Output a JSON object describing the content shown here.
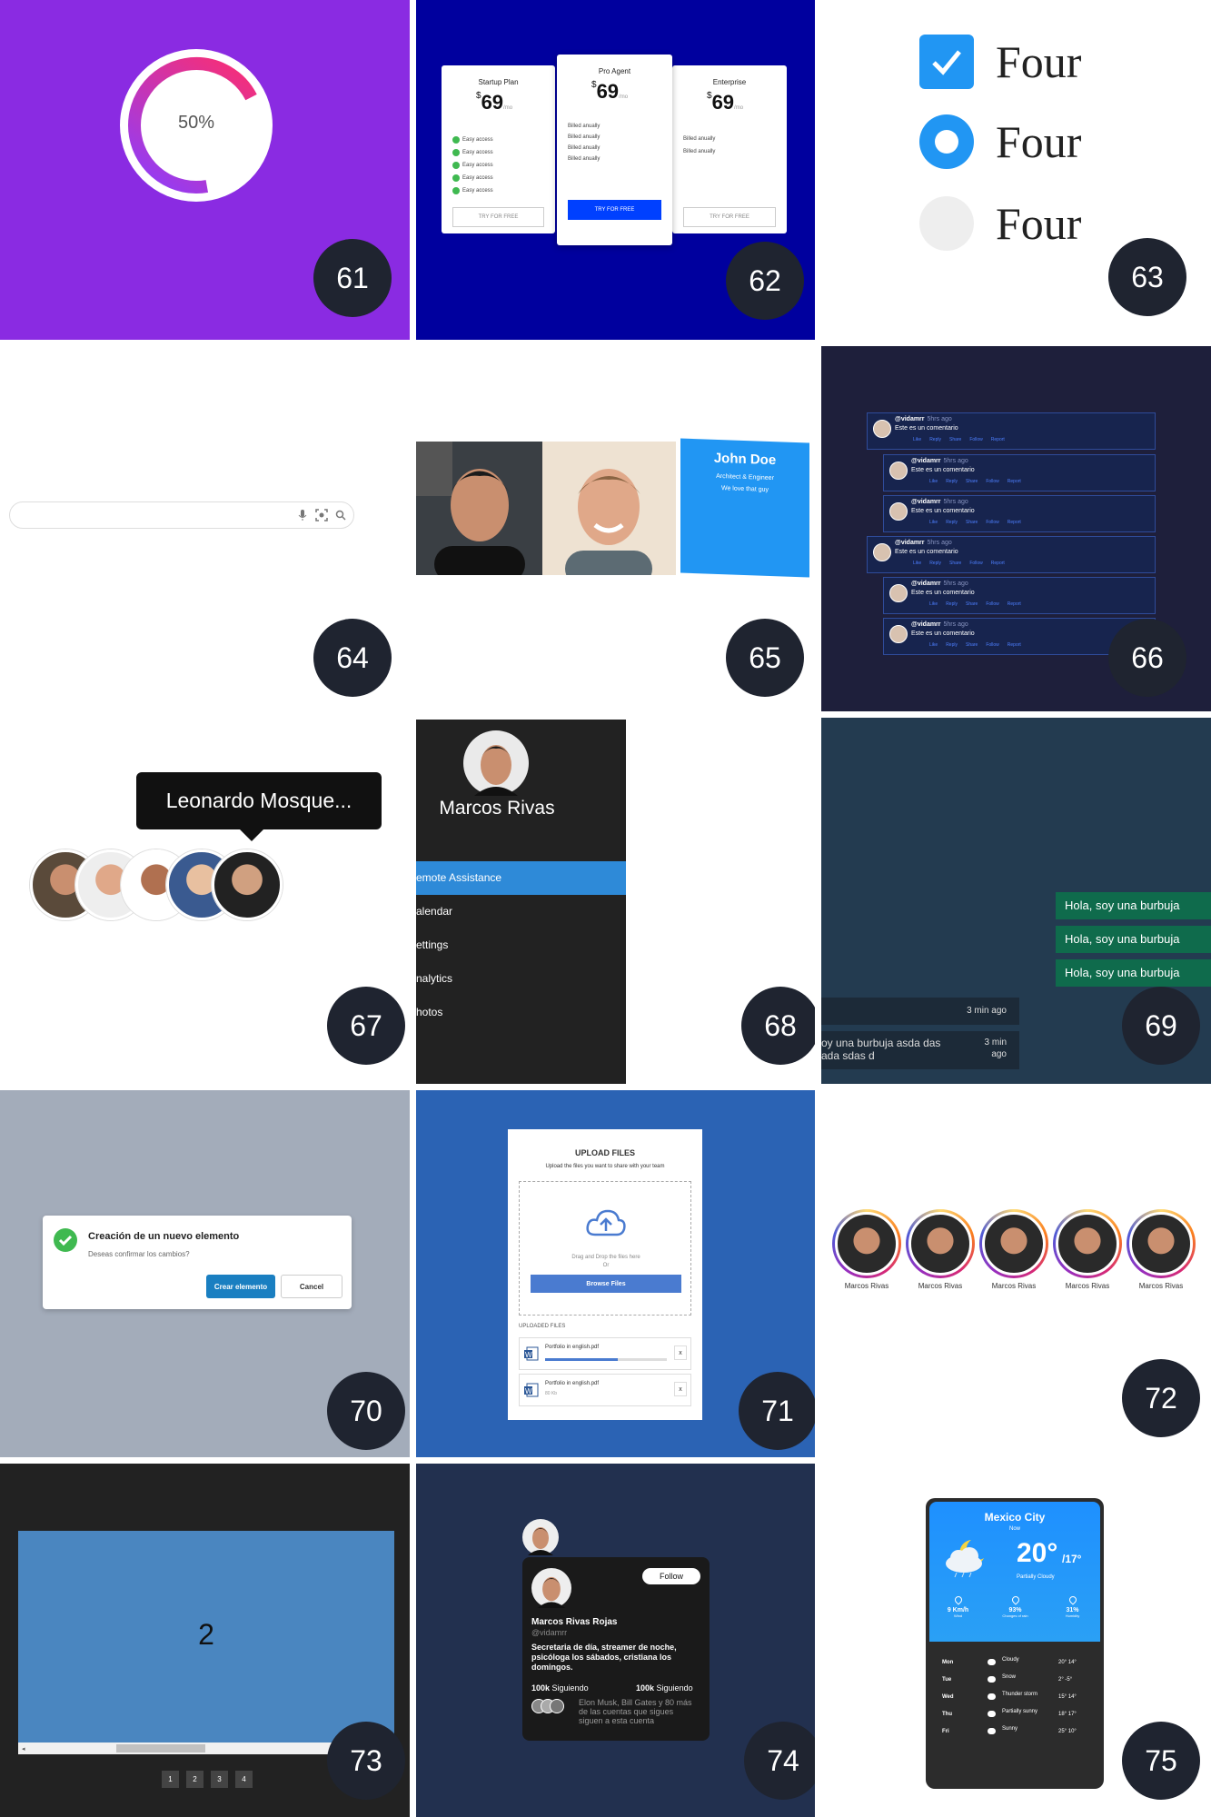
{
  "badges": [
    "61",
    "62",
    "63",
    "64",
    "65",
    "66",
    "67",
    "68",
    "69",
    "70",
    "71",
    "72",
    "73",
    "74",
    "75"
  ],
  "t61": {
    "label": "50%",
    "progress": 0.5
  },
  "t62": {
    "plans": [
      {
        "name": "Startup Plan",
        "currency": "$",
        "price": "69",
        "period": "/mo",
        "features": [
          "Easy access",
          "Easy access",
          "Easy access",
          "Easy access",
          "Easy access"
        ],
        "cta": "TRY FOR FREE"
      },
      {
        "name": "Pro Agent",
        "currency": "$",
        "price": "69",
        "period": "/mo",
        "features": [
          "Billed anually",
          "Billed anually",
          "Billed anually",
          "Billed anually"
        ],
        "cta": "TRY FOR FREE"
      },
      {
        "name": "Enterprise",
        "currency": "$",
        "price": "69",
        "period": "/mo",
        "features": [
          "Billed anually",
          "Billed anually"
        ],
        "cta": "TRY FOR FREE"
      }
    ]
  },
  "t63": {
    "options": [
      {
        "label": "Four",
        "type": "checkbox",
        "checked": true
      },
      {
        "label": "Four",
        "type": "radio",
        "checked": true
      },
      {
        "label": "Four",
        "type": "radio",
        "checked": false
      }
    ]
  },
  "t64": {
    "placeholder": ""
  },
  "t65": {
    "name": "John Doe",
    "role": "Architect & Engineer",
    "quote": "We love that guy"
  },
  "t66": {
    "comments": [
      {
        "user": "@vidamrr",
        "time": "5hrs ago",
        "text": "Este es un comentario",
        "actions": [
          "Like",
          "Reply",
          "Share",
          "Follow",
          "Report"
        ],
        "level": 0
      },
      {
        "user": "@vidamrr",
        "time": "5hrs ago",
        "text": "Este es un comentario",
        "actions": [
          "Like",
          "Reply",
          "Share",
          "Follow",
          "Report"
        ],
        "level": 1
      },
      {
        "user": "@vidamrr",
        "time": "5hrs ago",
        "text": "Este es un comentario",
        "actions": [
          "Like",
          "Reply",
          "Share",
          "Follow",
          "Report"
        ],
        "level": 1
      },
      {
        "user": "@vidamrr",
        "time": "5hrs ago",
        "text": "Este es un comentario",
        "actions": [
          "Like",
          "Reply",
          "Share",
          "Follow",
          "Report"
        ],
        "level": 0
      },
      {
        "user": "@vidamrr",
        "time": "5hrs ago",
        "text": "Este es un comentario",
        "actions": [
          "Like",
          "Reply",
          "Share",
          "Follow",
          "Report"
        ],
        "level": 1
      },
      {
        "user": "@vidamrr",
        "time": "5hrs ago",
        "text": "Este es un comentario",
        "actions": [
          "Like",
          "Reply",
          "Share",
          "Follow",
          "Report"
        ],
        "level": 1
      }
    ]
  },
  "t67": {
    "tooltip": "Leonardo Mosque..."
  },
  "t68": {
    "name": "Marcos Rivas",
    "menu": [
      "emote Assistance",
      "alendar",
      "ettings",
      "nalytics",
      "hotos"
    ],
    "active": 0
  },
  "t69": {
    "out": [
      "Hola, soy una burbuja",
      "Hola, soy una burbuja",
      "Hola, soy una burbuja"
    ],
    "in": [
      {
        "text": "",
        "time": "3 min ago"
      },
      {
        "text": "oy una burbuja asda das ada sdas d",
        "time": "3 min ago"
      }
    ]
  },
  "t70": {
    "title": "Creación de un nuevo elemento",
    "subtitle": "Deseas confirmar los cambios?",
    "confirm": "Crear elemento",
    "cancel": "Cancel"
  },
  "t71": {
    "title": "UPLOAD FILES",
    "subtitle": "Upload the files you want to share with your team",
    "drop": "Drag and Drop the files here",
    "or": "Or",
    "browse": "Browse Files",
    "uploaded_label": "UPLOADED FILES",
    "files": [
      {
        "name": "Portfolio in english.pdf",
        "size": "",
        "progress": 0.6,
        "close": "x"
      },
      {
        "name": "Portfolio in english.pdf",
        "size": "80 Kb",
        "progress": null,
        "close": "x"
      }
    ]
  },
  "t72": {
    "stories": [
      "Marcos Rivas",
      "Marcos Rivas",
      "Marcos Rivas",
      "Marcos Rivas",
      "Marcos Rivas"
    ]
  },
  "t73": {
    "slide": "2",
    "pages": [
      "1",
      "2",
      "3",
      "4"
    ]
  },
  "t74": {
    "follow": "Follow",
    "name": "Marcos Rivas Rojas",
    "handle": "@vidamrr",
    "bio": "Secretaria de día, streamer de noche, psicóloga los sábados, cristiana los domingos.",
    "following_count": "100k",
    "following_label": "Siguiendo",
    "followers_count": "100k",
    "followers_label": "Siguiendo",
    "mutual": "Elon Musk, Bill Gates y 80 más de las cuentas que sigues siguen a esta cuenta"
  },
  "t75": {
    "city": "Mexico City",
    "now": "Now",
    "temp": "20°",
    "low": "/17°",
    "desc": "Partially Cloudy",
    "stats": [
      {
        "value": "9 Km/h",
        "label": "Wind"
      },
      {
        "value": "93%",
        "label": "Changes of rain"
      },
      {
        "value": "31%",
        "label": "Humidity"
      }
    ],
    "days": [
      {
        "day": "Mon",
        "icon": "cloud-icon",
        "cond": "Cloudy",
        "temps": "20° 14°"
      },
      {
        "day": "Tue",
        "icon": "snow-icon",
        "cond": "Snow",
        "temps": "2° -5°"
      },
      {
        "day": "Wed",
        "icon": "storm-icon",
        "cond": "Thunder storm",
        "temps": "15° 14°"
      },
      {
        "day": "Thu",
        "icon": "partly-sunny-icon",
        "cond": "Partially sunny",
        "temps": "18° 17°"
      },
      {
        "day": "Fri",
        "icon": "sun-icon",
        "cond": "Sunny",
        "temps": "25° 10°"
      }
    ]
  }
}
